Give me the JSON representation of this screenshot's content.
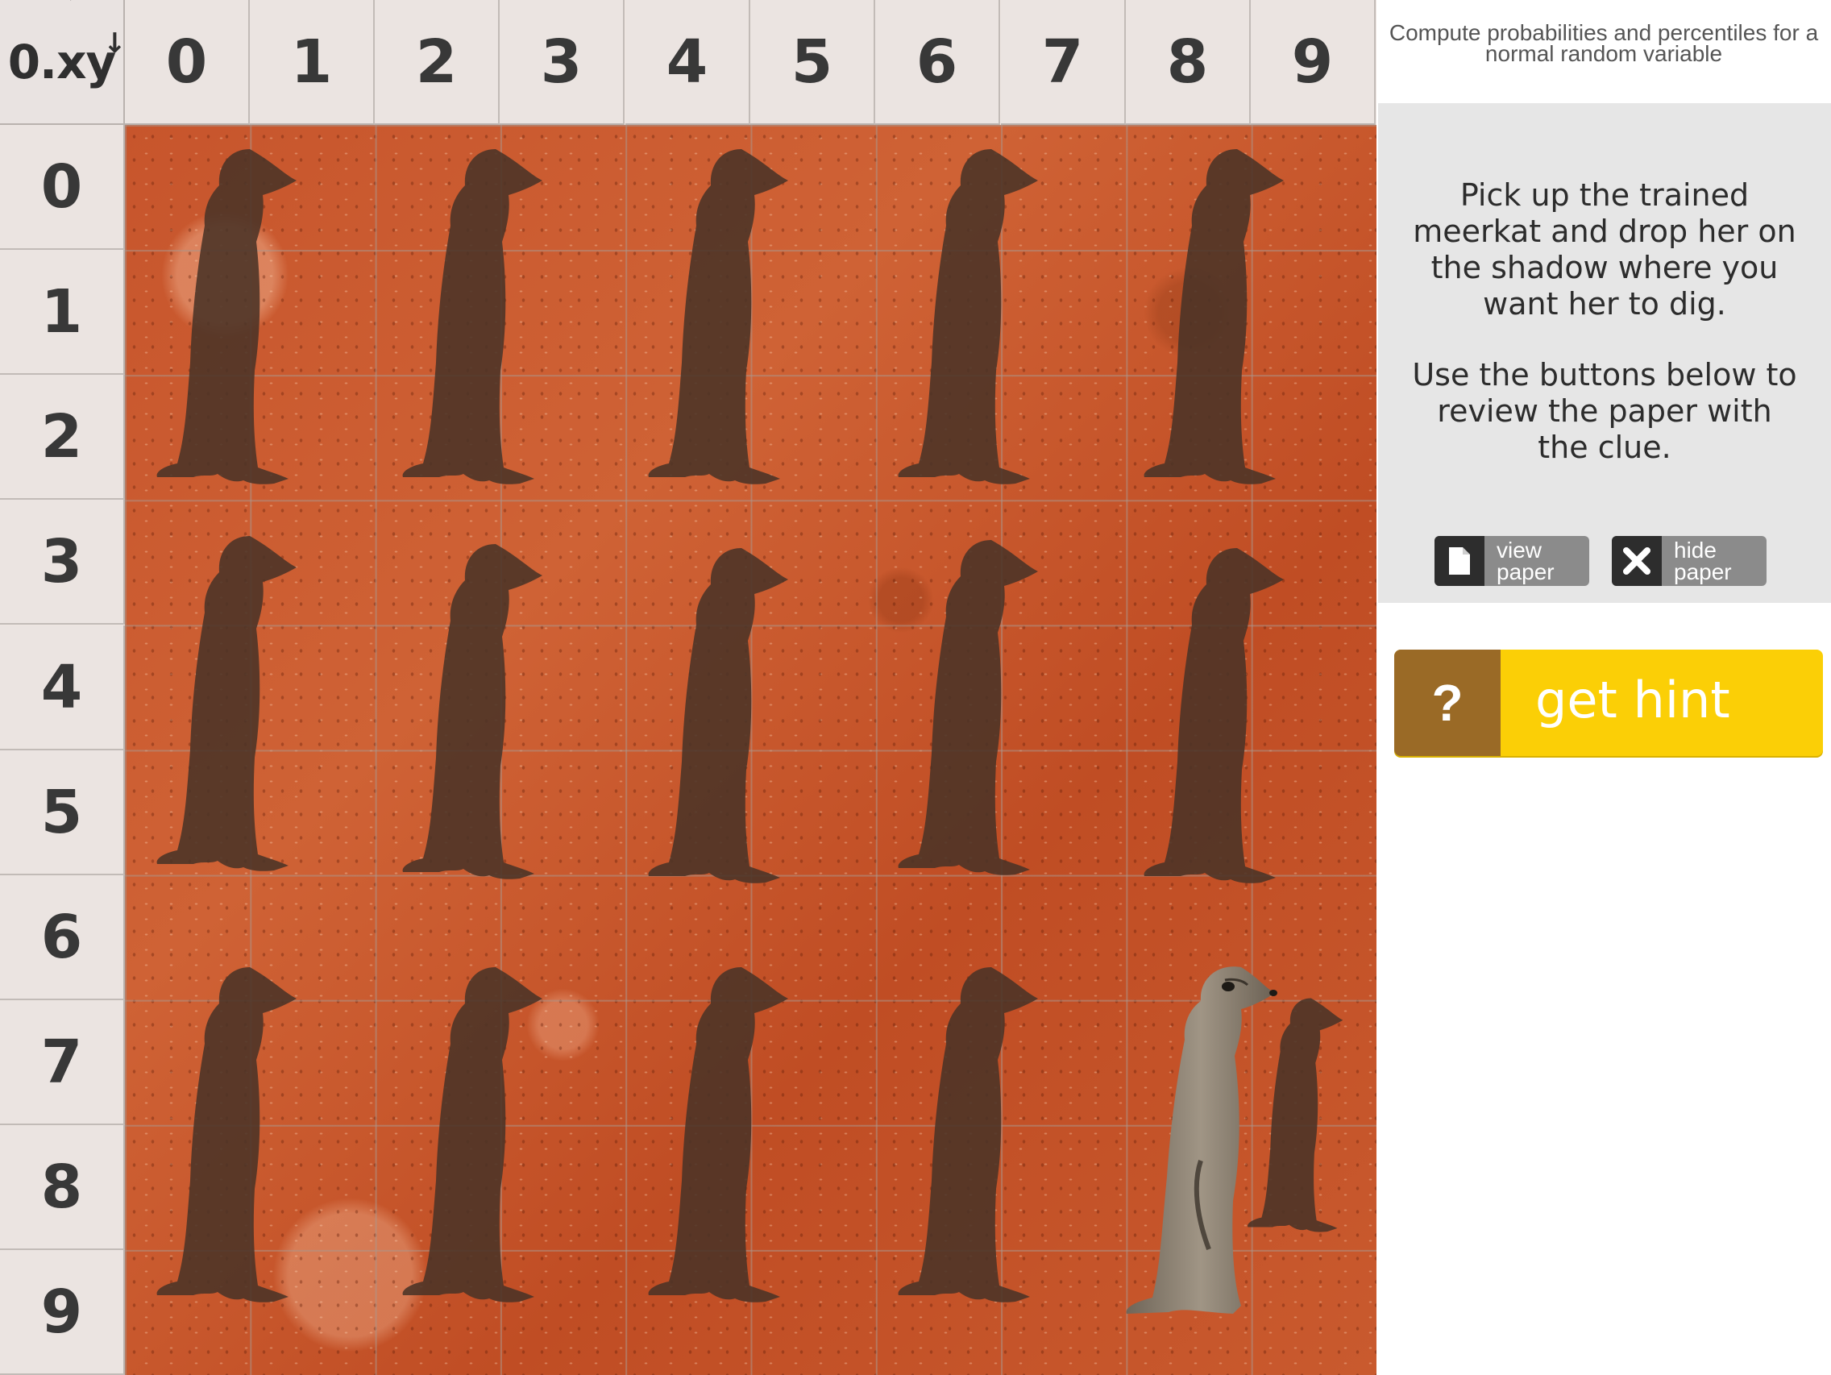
{
  "board": {
    "corner_label": "0.xy",
    "columns": [
      "0",
      "1",
      "2",
      "3",
      "4",
      "5",
      "6",
      "7",
      "8",
      "9"
    ],
    "rows": [
      "0",
      "1",
      "2",
      "3",
      "4",
      "5",
      "6",
      "7",
      "8",
      "9"
    ]
  },
  "panel": {
    "subtitle": "Compute probabilities and percentiles for a normal random variable",
    "instructions_1": "Pick up the trained meerkat and drop her on the shadow where you want her to dig.",
    "instructions_2": "Use the buttons below to review the paper with the clue.",
    "view_paper_label": "view paper",
    "hide_paper_label": "hide paper"
  },
  "hint": {
    "icon": "?",
    "label": "get hint"
  },
  "colors": {
    "sand": "#c95a2e",
    "shadow": "#4a3327",
    "hint_yellow": "#fbcf06",
    "hint_brown": "#9a6a26",
    "button_gray": "#8b8b8b"
  },
  "icons": {
    "view_paper": "document-icon",
    "hide_paper": "close-x-icon",
    "hint": "question-icon"
  }
}
